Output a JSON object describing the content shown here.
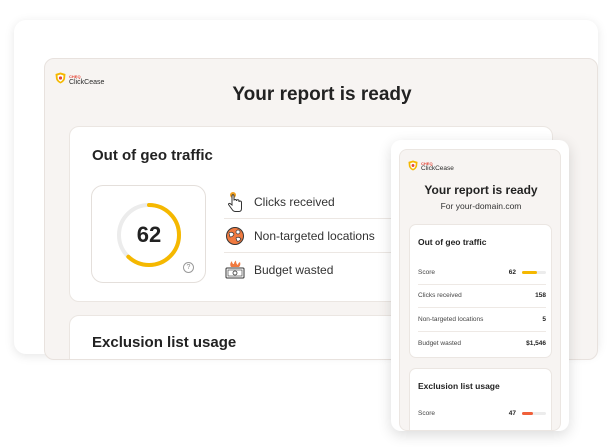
{
  "brand": {
    "small": "CHEQ",
    "name": "ClickCease"
  },
  "colors": {
    "accent_yellow": "#f5b800",
    "accent_red": "#f0603a",
    "gauge_track": "#ececec"
  },
  "desktop": {
    "title": "Your report is ready",
    "geo": {
      "title": "Out of geo traffic",
      "score": "62",
      "score_progress": 0.62,
      "help": "?",
      "metrics": [
        {
          "label": "Clicks received",
          "icon": "pointer-hand-icon"
        },
        {
          "label": "Non-targeted locations",
          "icon": "globe-pin-icon"
        },
        {
          "label": "Budget wasted",
          "icon": "money-burn-icon"
        }
      ]
    },
    "exclusion": {
      "title": "Exclusion list usage"
    }
  },
  "mobile": {
    "title": "Your report is ready",
    "subtitle": "For your-domain.com",
    "geo": {
      "title": "Out of geo traffic",
      "score_label": "Score",
      "score": "62",
      "score_progress": 0.62,
      "rows": [
        {
          "label": "Clicks received",
          "value": "158"
        },
        {
          "label": "Non-targeted locations",
          "value": "5"
        },
        {
          "label": "Budget wasted",
          "value": "$1,546"
        }
      ]
    },
    "exclusion": {
      "title": "Exclusion list usage",
      "score_label": "Score",
      "score": "47",
      "score_progress": 0.47
    }
  }
}
